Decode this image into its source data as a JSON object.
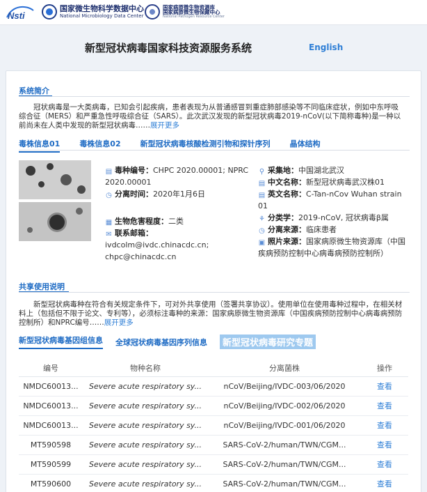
{
  "header": {
    "logo1_text": "Nsti",
    "logo2_cn": "国家微生物科学数据中心",
    "logo2_en": "National Microbiology Data Center",
    "logo3_cn1": "国家病原微生物资源库",
    "logo3_cn2": "国家病原微生物保藏中心",
    "logo3_en": "National Pathogen Resource Center"
  },
  "page": {
    "title": "新型冠状病毒国家科技资源服务系统",
    "language_link": "English"
  },
  "intro": {
    "heading": "系统简介",
    "text": "冠状病毒是一大类病毒，已知会引起疾病，患者表现为从普通感冒到重症肺部感染等不同临床症状，例如中东呼吸综合征（MERS）和严重急性呼吸综合征（SARS）。此次武汉发现的新型冠状病毒2019-nCoV(以下简称毒种)是一种以前尚未在人类中发现的新型冠状病毒……",
    "more": "展开更多"
  },
  "tabs": [
    "毒株信息01",
    "毒株信息02",
    "新型冠状病毒核酸检测引物和探针序列",
    "晶体结构"
  ],
  "strain": {
    "left": [
      {
        "label": "毒种编号：",
        "value": "CHPC 2020.00001; NPRC 2020.00001",
        "icon": "doc-icon"
      },
      {
        "label": "分离时间：",
        "value": "2020年1月6日",
        "icon": "clock-icon"
      },
      {
        "label": "生物危害程度：",
        "value": "二类",
        "icon": "grid-icon"
      },
      {
        "label": "联系邮箱：",
        "value": "ivdcolm@ivdc.chinacdc.cn; chpc@chinacdc.cn",
        "icon": "mail-icon"
      }
    ],
    "right": [
      {
        "label": "采集地：",
        "value": "中国湖北武汉",
        "icon": "pin-icon"
      },
      {
        "label": "中文名称：",
        "value": "新型冠状病毒武汉株01",
        "icon": "doc-icon"
      },
      {
        "label": "英文名称：",
        "value": "C-Tan-nCov Wuhan strain 01",
        "icon": "doc-icon"
      },
      {
        "label": "分类学：",
        "value": "2019-nCoV, 冠状病毒β属",
        "icon": "tree-icon"
      },
      {
        "label": "分离来源：",
        "value": "临床患者",
        "icon": "clock-icon"
      },
      {
        "label": "照片来源：",
        "value": "国家病原微生物资源库（中国疾病预防控制中心病毒病预防控制所）",
        "icon": "photo-icon"
      }
    ]
  },
  "share": {
    "heading": "共享使用说明",
    "text": "新型冠状病毒种在符合有关规定条件下，可对外共享使用（签署共享协议）。使用单位在使用毒种过程中，在相关材料上（包括但不限于论文、专利等），必须标注毒种的来源：国家病原微生物资源库（中国疾病预防控制中心病毒病预防控制所）和NPRC编号……",
    "more": "展开更多"
  },
  "links": [
    "新型冠状病毒基因组信息",
    "全球冠状病毒基因序列信息",
    "新型冠状病毒研究专题"
  ],
  "table": {
    "headers": [
      "编号",
      "物种名称",
      "分离菌株",
      "操作"
    ],
    "rows": [
      {
        "id": "NMDC60013...",
        "species": "Severe acute respiratory sy...",
        "strain": "nCoV/Beijing/IVDC-003/06/2020",
        "action": "查看"
      },
      {
        "id": "NMDC60013...",
        "species": "Severe acute respiratory sy...",
        "strain": "nCoV/Beijing/IVDC-002/06/2020",
        "action": "查看"
      },
      {
        "id": "NMDC60013...",
        "species": "Severe acute respiratory sy...",
        "strain": "nCoV/Beijing/IVDC-001/06/2020",
        "action": "查看"
      },
      {
        "id": "MT590598",
        "species": "Severe acute respiratory sy...",
        "strain": "SARS-CoV-2/human/TWN/CGM...",
        "action": "查看"
      },
      {
        "id": "MT590599",
        "species": "Severe acute respiratory sy...",
        "strain": "SARS-CoV-2/human/TWN/CGM...",
        "action": "查看"
      },
      {
        "id": "MT590600",
        "species": "Severe acute respiratory sy...",
        "strain": "SARS-CoV-2/human/TWN/CGM...",
        "action": "查看"
      }
    ]
  }
}
